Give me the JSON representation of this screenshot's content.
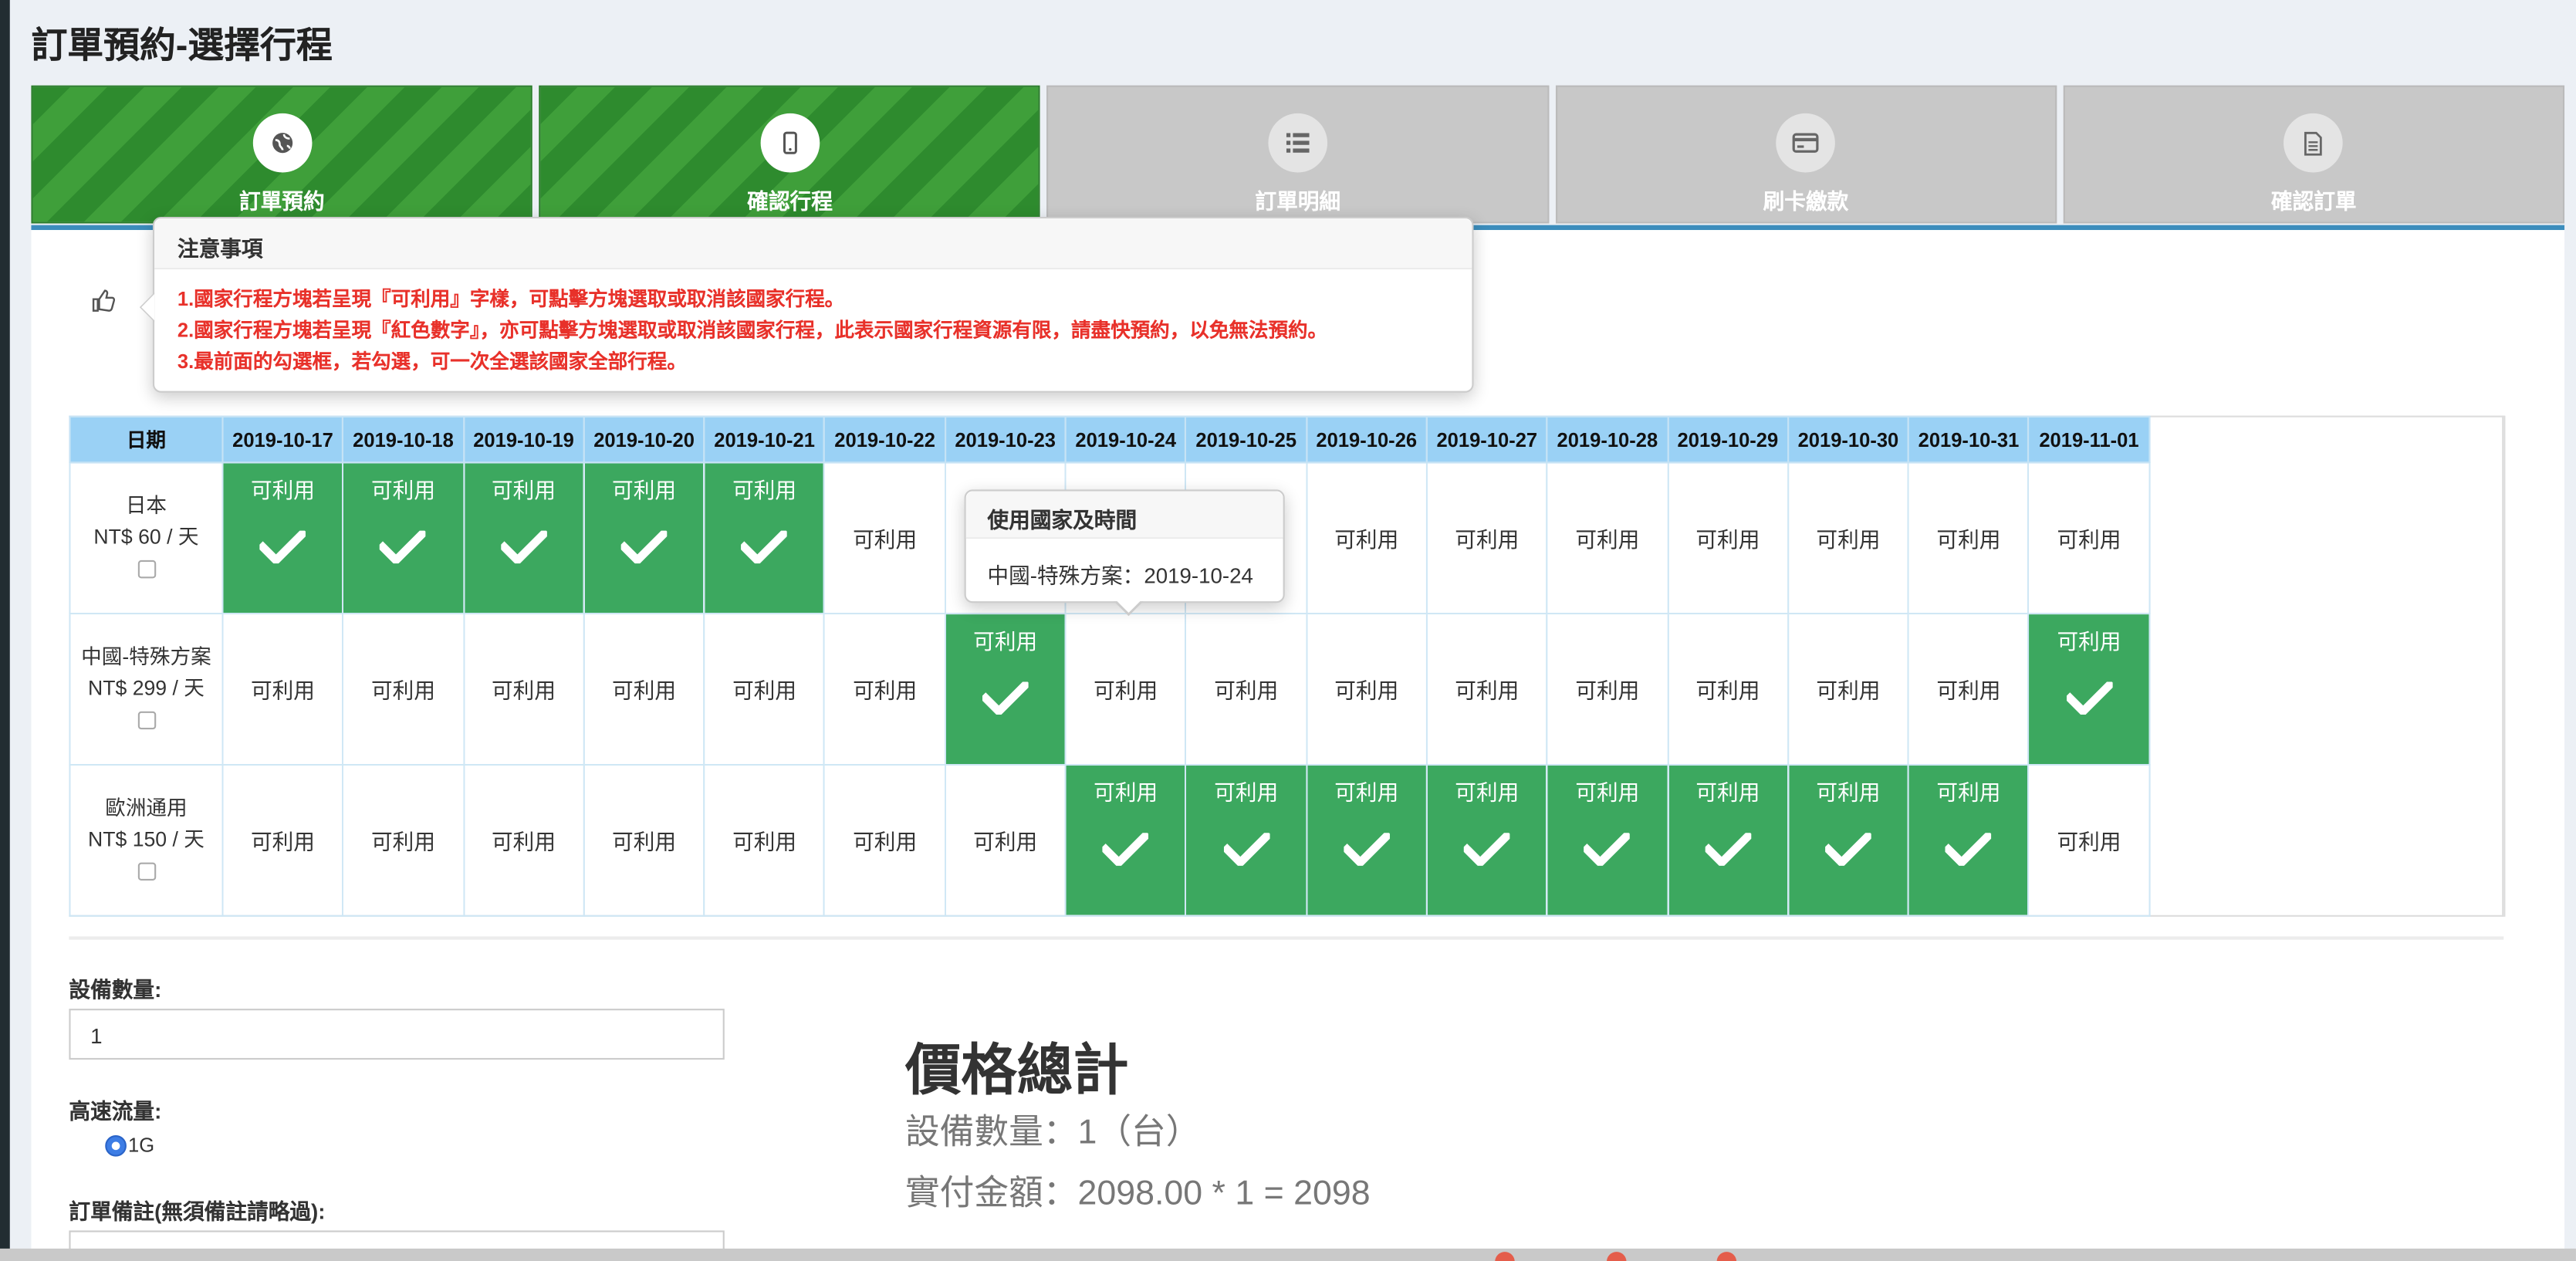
{
  "page": {
    "title": "訂單預約-選擇行程"
  },
  "steps": [
    {
      "label": "訂單預約",
      "icon": "globe-icon",
      "state": "done"
    },
    {
      "label": "確認行程",
      "icon": "mobile-icon",
      "state": "done"
    },
    {
      "label": "訂單明細",
      "icon": "list-icon",
      "state": "pending"
    },
    {
      "label": "刷卡繳款",
      "icon": "credit-card-icon",
      "state": "pending"
    },
    {
      "label": "確認訂單",
      "icon": "document-icon",
      "state": "pending"
    }
  ],
  "colors": {
    "step_done": "#2e8b2e",
    "selected_cell": "#3ca85f",
    "header_bg": "#9ad1f5",
    "notice_text": "#e8312a",
    "accent": "#3c8dbc"
  },
  "notice": {
    "title": "注意事項",
    "lines": [
      "1.國家行程方塊若呈現『可利用』字樣，可點擊方塊選取或取消該國家行程。",
      "2.國家行程方塊若呈現『紅色數字』，亦可點擊方塊選取或取消該國家行程，此表示國家行程資源有限，請盡快預約，以免無法預約。",
      "3.最前面的勾選框，若勾選，可一次全選該國家全部行程。"
    ]
  },
  "tooltip": {
    "title": "使用國家及時間",
    "body": "中國-特殊方案：2019-10-24"
  },
  "schedule": {
    "date_header": "日期",
    "dates": [
      "2019-10-17",
      "2019-10-18",
      "2019-10-19",
      "2019-10-20",
      "2019-10-21",
      "2019-10-22",
      "2019-10-23",
      "2019-10-24",
      "2019-10-25",
      "2019-10-26",
      "2019-10-27",
      "2019-10-28",
      "2019-10-29",
      "2019-10-30",
      "2019-10-31",
      "2019-11-01"
    ],
    "cell_text": "可利用",
    "rows": [
      {
        "country": "日本",
        "price": "NT$ 60 / 天",
        "selected": [
          1,
          1,
          1,
          1,
          1,
          0,
          0,
          0,
          0,
          0,
          0,
          0,
          0,
          0,
          0,
          0
        ]
      },
      {
        "country": "中國-特殊方案",
        "price": "NT$ 299 / 天",
        "selected": [
          0,
          0,
          0,
          0,
          0,
          0,
          1,
          0,
          0,
          0,
          0,
          0,
          0,
          0,
          0,
          1
        ]
      },
      {
        "country": "歐洲通用",
        "price": "NT$ 150 / 天",
        "selected": [
          0,
          0,
          0,
          0,
          0,
          0,
          0,
          1,
          1,
          1,
          1,
          1,
          1,
          1,
          1,
          0
        ]
      }
    ]
  },
  "form": {
    "device_qty_label": "設備數量:",
    "device_qty_value": "1",
    "speed_label": "高速流量:",
    "speed_option": "1G",
    "remark_label": "訂單備註(無須備註請略過):"
  },
  "summary": {
    "title": "價格總計",
    "device_line": "設備數量：1（台）",
    "amount_line": "實付金額：2098.00 * 1 = 2098"
  }
}
